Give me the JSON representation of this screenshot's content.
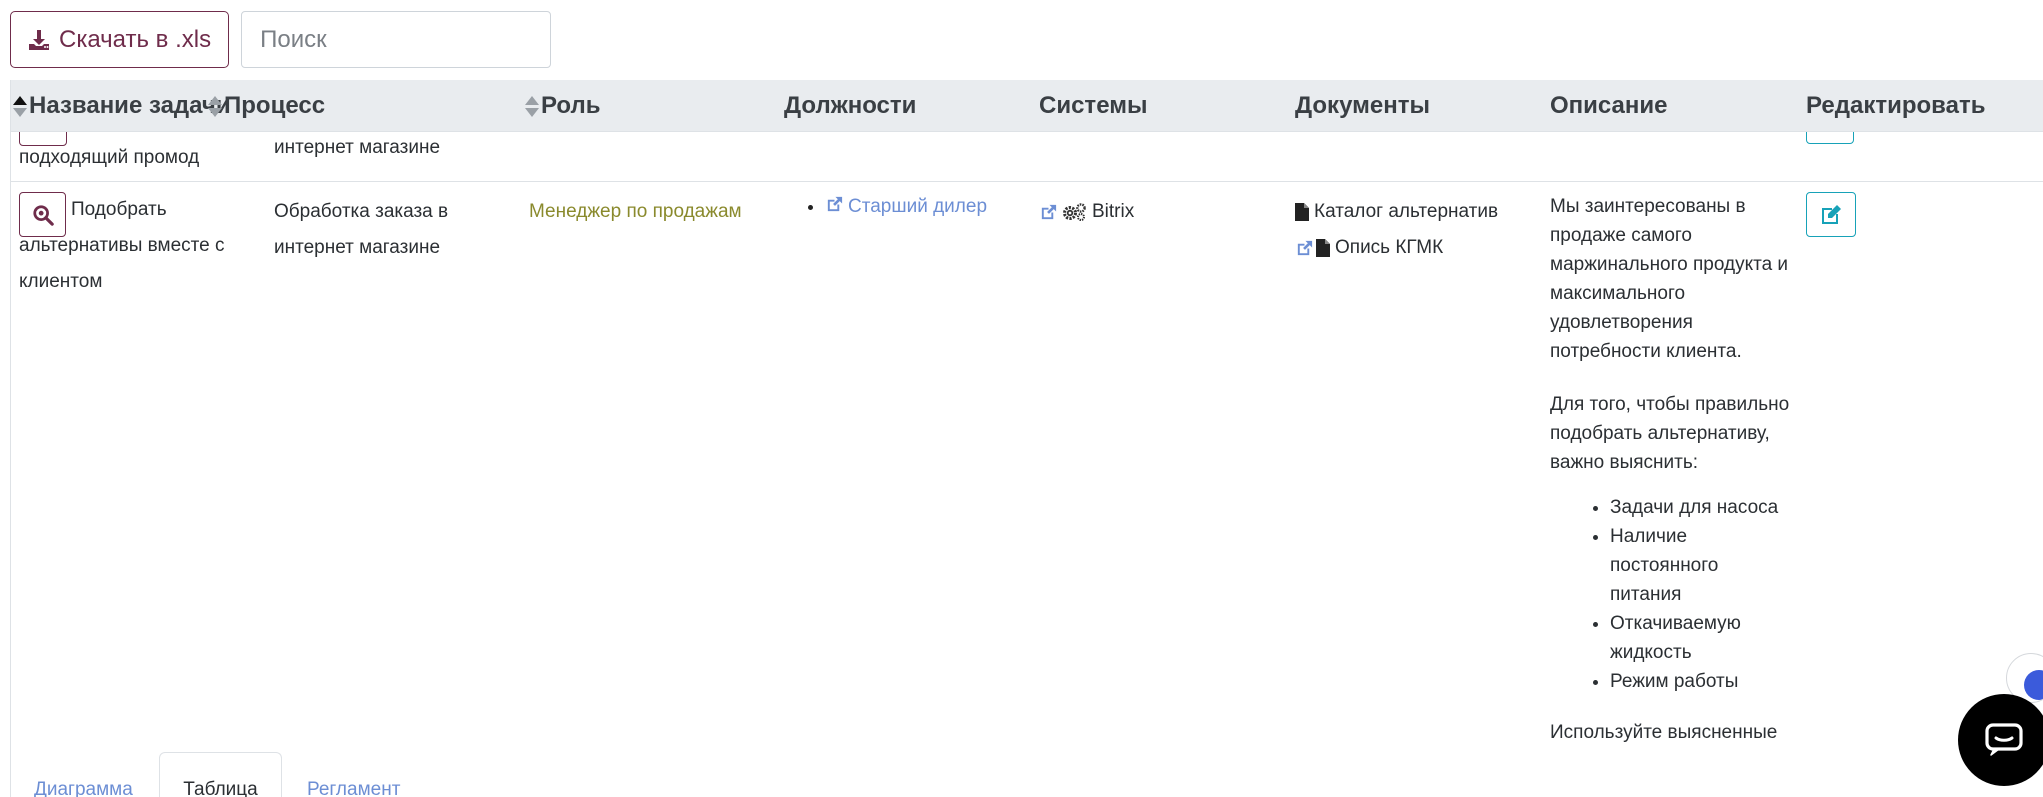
{
  "toolbar": {
    "download_label": "Скачать в .xls",
    "search_placeholder": "Поиск",
    "search_value": ""
  },
  "table": {
    "headers": {
      "task": "Название задачи",
      "process": "Процесс",
      "role": "Роль",
      "positions": "Должности",
      "systems": "Системы",
      "documents": "Документы",
      "description": "Описание",
      "edit": "Редактировать"
    },
    "prev_row": {
      "task_tail": "подходящий промод",
      "process_tail": "интернет магазине"
    },
    "row": {
      "task": "Подобрать альтернативы вместе с клиентом",
      "process": "Обработка заказа в интернет магазине",
      "role": "Менеджер по продажам",
      "positions": [
        "Старший дилер"
      ],
      "systems": [
        "Bitrix"
      ],
      "documents": [
        "Каталог альтернатив",
        "Опись КГМК"
      ],
      "description": {
        "p1": "Мы заинтересованы в продаже самого маржинального продукта и максимального удовлетворения потребности клиента.",
        "p2": "Для того, чтобы правильно подобрать альтернативу, важно выяснить:",
        "items": [
          "Задачи для насоса",
          "Наличие постоянного питания",
          "Откачиваемую жидкость",
          "Режим работы"
        ],
        "p3": "Используйте выясненные"
      }
    }
  },
  "tabs": [
    "Диаграмма",
    "Таблица",
    "Регламент"
  ],
  "active_tab": "Таблица",
  "colors": {
    "brand": "#6f2c4b",
    "link": "#6c8ed4",
    "role": "#8a8a2d",
    "edit": "#17a2b8",
    "header_bg": "#e9ecef"
  }
}
